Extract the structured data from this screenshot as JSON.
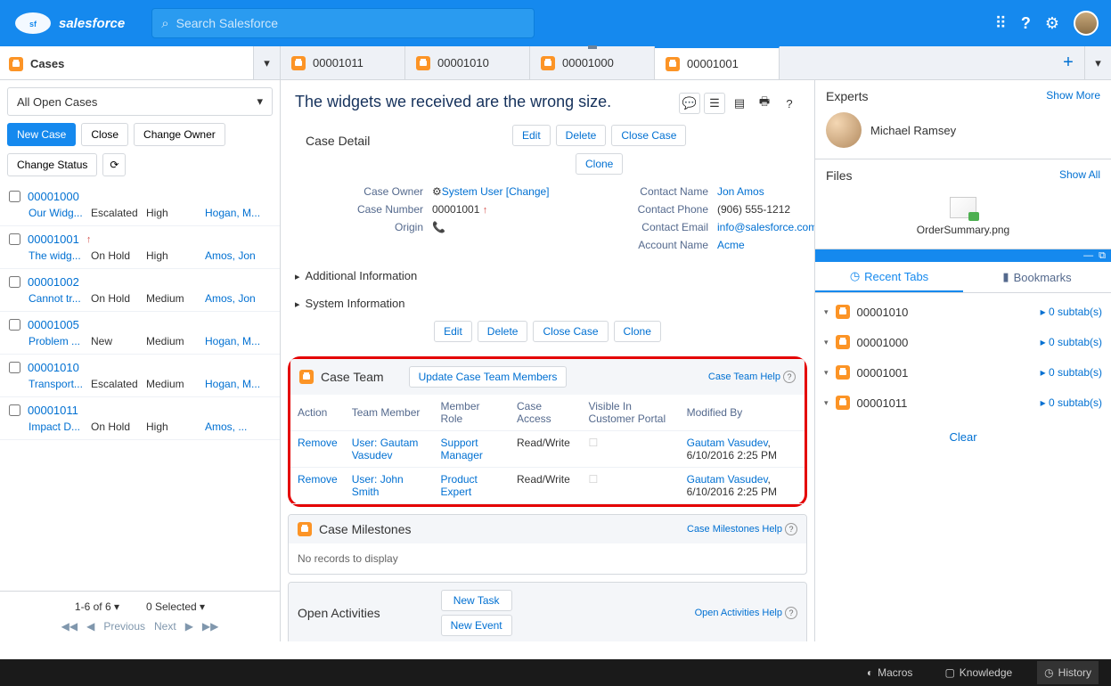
{
  "search": {
    "placeholder": "Search Salesforce"
  },
  "left_header": {
    "title": "Cases"
  },
  "center_tabs": [
    {
      "label": "00001011",
      "active": false,
      "pinned": false
    },
    {
      "label": "00001010",
      "active": false,
      "pinned": false
    },
    {
      "label": "00001000",
      "active": false,
      "pinned": true
    },
    {
      "label": "00001001",
      "active": true,
      "pinned": false
    }
  ],
  "view_select": "All Open Cases",
  "buttons": {
    "new_case": "New Case",
    "close": "Close",
    "change_owner": "Change Owner",
    "change_status": "Change Status",
    "edit": "Edit",
    "delete": "Delete",
    "close_case": "Close Case",
    "clone": "Clone",
    "update_team": "Update Case Team Members",
    "new_task": "New Task",
    "new_event": "New Event"
  },
  "case_list": [
    {
      "num": "00001000",
      "arrow": false,
      "subj": "Our Widg...",
      "status": "Escalated",
      "pri": "High",
      "owner": "Hogan, M..."
    },
    {
      "num": "00001001",
      "arrow": true,
      "subj": "The widg...",
      "status": "On Hold",
      "pri": "High",
      "owner": "Amos, Jon"
    },
    {
      "num": "00001002",
      "arrow": false,
      "subj": "Cannot tr...",
      "status": "On Hold",
      "pri": "Medium",
      "owner": "Amos, Jon"
    },
    {
      "num": "00001005",
      "arrow": false,
      "subj": "Problem ...",
      "status": "New",
      "pri": "Medium",
      "owner": "Hogan, M..."
    },
    {
      "num": "00001010",
      "arrow": false,
      "subj": "Transport...",
      "status": "Escalated",
      "pri": "Medium",
      "owner": "Hogan, M..."
    },
    {
      "num": "00001011",
      "arrow": false,
      "subj": "Impact D...",
      "status": "On Hold",
      "pri": "High",
      "owner": "Amos, ..."
    }
  ],
  "pager": {
    "range": "1-6 of 6",
    "selected": "0 Selected",
    "prev": "Previous",
    "next": "Next"
  },
  "detail": {
    "title": "The widgets we received are the wrong size.",
    "section": "Case Detail",
    "labels": {
      "owner": "Case Owner",
      "number": "Case Number",
      "origin": "Origin",
      "cname": "Contact Name",
      "cphone": "Contact Phone",
      "cemail": "Contact Email",
      "account": "Account Name"
    },
    "values": {
      "owner": "System User",
      "owner_change": "[Change]",
      "number": "00001001",
      "cname": "Jon Amos",
      "cphone": "(906) 555-1212",
      "cemail": "info@salesforce.com",
      "account": "Acme"
    },
    "addl": "Additional Information",
    "sys": "System Information"
  },
  "case_team": {
    "title": "Case Team",
    "help": "Case Team Help",
    "cols": {
      "action": "Action",
      "member": "Team Member",
      "role": "Member Role",
      "access": "Case Access",
      "portal": "Visible In Customer Portal",
      "modby": "Modified By"
    },
    "rows": [
      {
        "action": "Remove",
        "member": "User: Gautam Vasudev",
        "role": "Support Manager",
        "access": "Read/Write",
        "modby_name": "Gautam Vasudev",
        "modby_ts": "6/10/2016 2:25 PM"
      },
      {
        "action": "Remove",
        "member": "User: John Smith",
        "role": "Product Expert",
        "access": "Read/Write",
        "modby_name": "Gautam Vasudev",
        "modby_ts": "6/10/2016 2:25 PM"
      }
    ]
  },
  "milestones": {
    "title": "Case Milestones",
    "help": "Case Milestones Help",
    "empty": "No records to display"
  },
  "activities": {
    "title": "Open Activities",
    "help": "Open Activities Help"
  },
  "right": {
    "experts": {
      "title": "Experts",
      "link": "Show More",
      "name": "Michael Ramsey"
    },
    "files": {
      "title": "Files",
      "link": "Show All",
      "name": "OrderSummary.png"
    },
    "tabs": {
      "recent": "Recent Tabs",
      "bookmarks": "Bookmarks"
    },
    "items": [
      {
        "num": "00001010",
        "sub": "0 subtab(s)"
      },
      {
        "num": "00001000",
        "sub": "0 subtab(s)"
      },
      {
        "num": "00001001",
        "sub": "0 subtab(s)"
      },
      {
        "num": "00001011",
        "sub": "0 subtab(s)"
      }
    ],
    "clear": "Clear"
  },
  "footer": {
    "macros": "Macros",
    "knowledge": "Knowledge",
    "history": "History"
  }
}
